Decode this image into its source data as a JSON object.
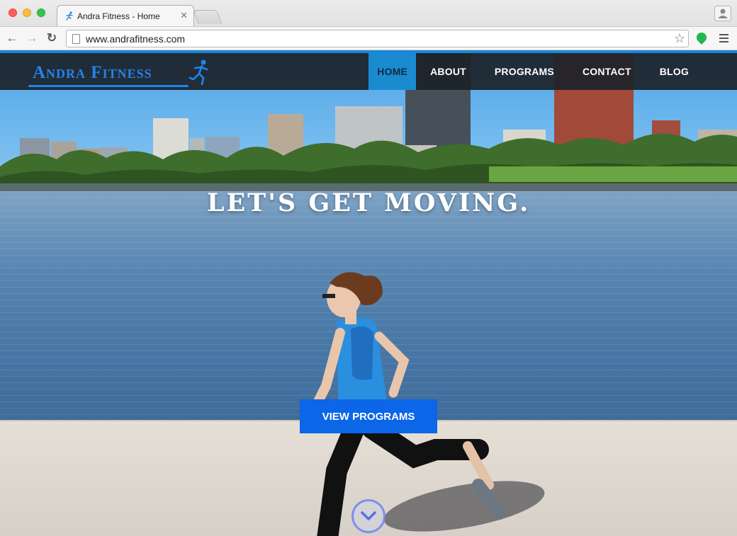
{
  "browser": {
    "tab_title": "Andra Fitness - Home",
    "tab_close": "✕",
    "url": "www.andrafitness.com",
    "back": "←",
    "forward": "→",
    "reload": "↻",
    "bookmark_star": "☆"
  },
  "site": {
    "logo_text": "Andra Fitness",
    "nav": [
      {
        "label": "HOME",
        "active": true
      },
      {
        "label": "ABOUT"
      },
      {
        "label": "PROGRAMS"
      },
      {
        "label": "CONTACT"
      },
      {
        "label": "BLOG"
      }
    ],
    "headline": "LET'S GET MOVING.",
    "cta_label": "VIEW PROGRAMS"
  },
  "colors": {
    "accent_blue": "#1b8bd0",
    "logo_blue": "#2384ea",
    "cta_blue": "#0b66e8",
    "nav_bg": "#1c2228"
  },
  "icons": [
    "back-arrow-icon",
    "forward-arrow-icon",
    "reload-icon",
    "page-icon",
    "star-icon",
    "extension-icon",
    "menu-icon",
    "user-icon",
    "runner-logo-icon",
    "chevron-down-icon"
  ]
}
